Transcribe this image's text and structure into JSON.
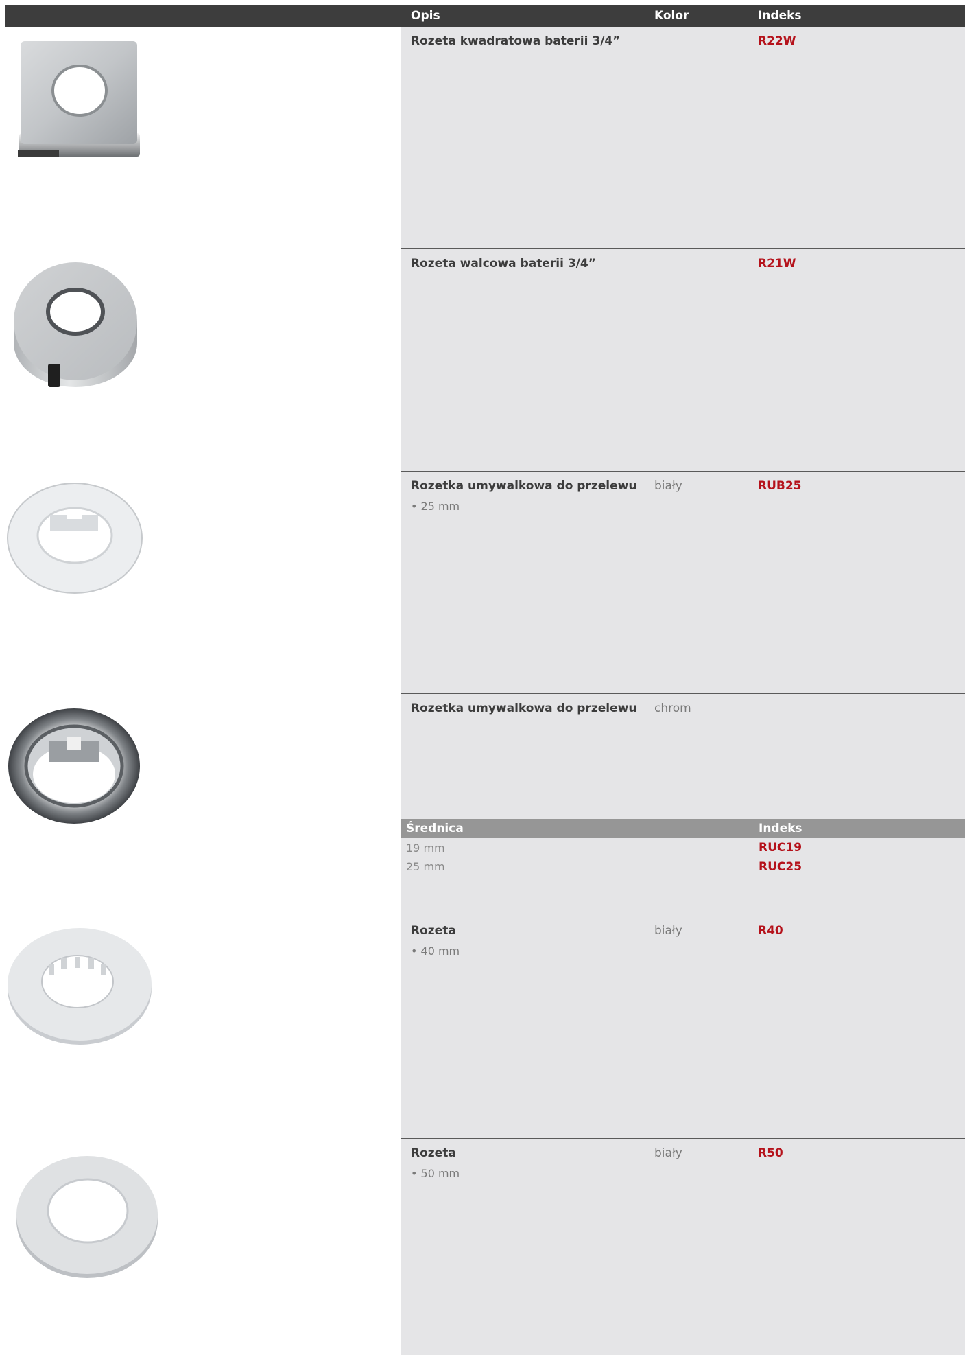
{
  "header": {
    "opis": "Opis",
    "kolor": "Kolor",
    "indeks": "Indeks"
  },
  "products": [
    {
      "name": "Rozeta kwadratowa baterii 3/4”",
      "color": "",
      "index": "R22W",
      "note": "",
      "image_icon": "square-rosette-chrome-icon"
    },
    {
      "name": "Rozeta walcowa baterii 3/4”",
      "color": "",
      "index": "R21W",
      "note": "",
      "image_icon": "cylindrical-rosette-chrome-icon"
    },
    {
      "name": "Rozetka umywalkowa do przelewu",
      "color": "biały",
      "index": "RUB25",
      "note": "• 25 mm",
      "image_icon": "overflow-ring-white-icon"
    },
    {
      "name": "Rozetka umywalkowa do przelewu",
      "color": "chrom",
      "index": "",
      "note": "",
      "image_icon": "overflow-ring-chrome-icon"
    },
    {
      "name": "Rozeta",
      "color": "biały",
      "index": "R40",
      "note": "• 40 mm",
      "image_icon": "rosette-40-white-icon"
    },
    {
      "name": "Rozeta",
      "color": "biały",
      "index": "R50",
      "note": "• 50 mm",
      "image_icon": "rosette-50-white-icon"
    }
  ],
  "subtable": {
    "header_srednica": "Średnica",
    "header_indeks": "Indeks",
    "rows": [
      {
        "size": "19 mm",
        "index": "RUC19"
      },
      {
        "size": "25 mm",
        "index": "RUC25"
      }
    ]
  },
  "colors": {
    "accent_red": "#b5121b",
    "header_bg": "#3d3d3d",
    "panel_bg": "#e5e5e7",
    "subheader_bg": "#969696"
  }
}
